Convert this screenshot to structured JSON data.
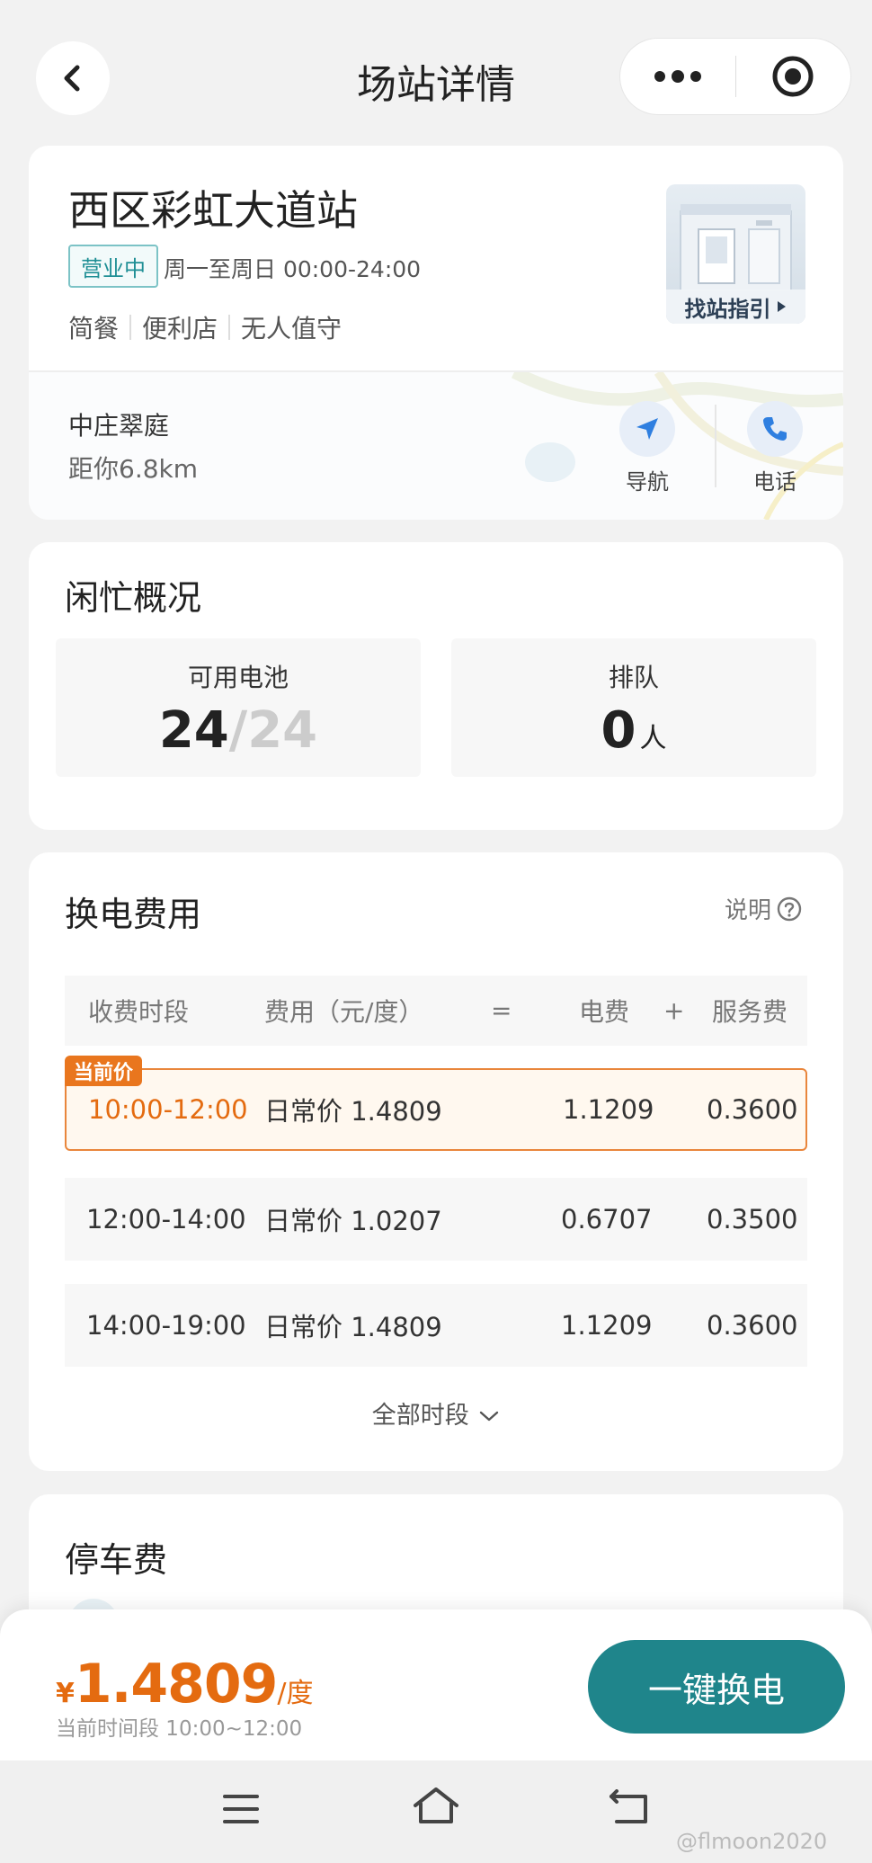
{
  "header": {
    "title": "场站详情"
  },
  "station": {
    "name": "西区彩虹大道站",
    "status": "营业中",
    "hours": "周一至周日 00:00-24:00",
    "tags": [
      "简餐",
      "便利店",
      "无人值守"
    ],
    "guide_label": "找站指引",
    "address": "中庄翠庭",
    "distance": "距你6.8km",
    "nav_label": "导航",
    "phone_label": "电话"
  },
  "busy": {
    "title": "闲忙概况",
    "battery_label": "可用电池",
    "battery_available": "24",
    "battery_total": "/24",
    "queue_label": "排队",
    "queue_count": "0",
    "queue_unit": "人"
  },
  "fees": {
    "title": "换电费用",
    "help_label": "说明",
    "headers": {
      "period": "收费时段",
      "fee": "费用（元/度）",
      "eq": "=",
      "electric": "电费",
      "plus": "+",
      "service": "服务费"
    },
    "current_tag": "当前价",
    "rows": [
      {
        "time": "10:00-12:00",
        "fee": "日常价 1.4809",
        "electric": "1.1209",
        "service": "0.3600"
      },
      {
        "time": "12:00-14:00",
        "fee": "日常价 1.0207",
        "electric": "0.6707",
        "service": "0.3500"
      },
      {
        "time": "14:00-19:00",
        "fee": "日常价 1.4809",
        "electric": "1.1209",
        "service": "0.3600"
      }
    ],
    "all_periods": "全部时段"
  },
  "parking": {
    "title": "停车费"
  },
  "bottom": {
    "currency": "¥",
    "price": "1.4809",
    "unit": "/度",
    "period": "当前时间段 10:00~12:00",
    "button": "一键换电"
  },
  "watermark": "@flmoon2020",
  "colors": {
    "accent": "#1f858b",
    "price": "#e46b10",
    "badge": "#1f8f95"
  }
}
